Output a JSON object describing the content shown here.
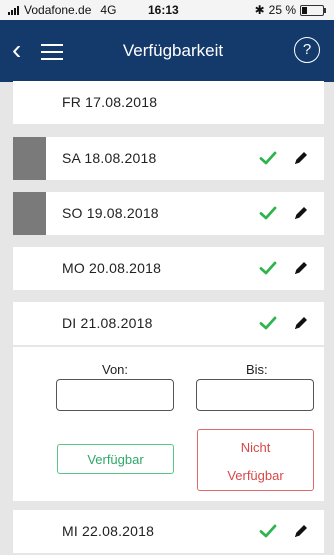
{
  "status_bar": {
    "carrier": "Vodafone.de",
    "network": "4G",
    "time": "16:13",
    "bluetooth": "✱",
    "battery_text": "25 %",
    "battery_level": 0.25
  },
  "header": {
    "back_icon": "‹",
    "title": "Verfügbarkeit",
    "help_label": "?"
  },
  "days": [
    {
      "date": "FR 17.08.2018",
      "marked": false,
      "actions": false
    },
    {
      "date": "SA 18.08.2018",
      "marked": true,
      "actions": true
    },
    {
      "date": "SO 19.08.2018",
      "marked": true,
      "actions": true
    },
    {
      "date": "MO 20.08.2018",
      "marked": false,
      "actions": true
    },
    {
      "date": "DI 21.08.2018",
      "marked": false,
      "actions": true
    },
    {
      "date": "MI 22.08.2018",
      "marked": false,
      "actions": true
    }
  ],
  "editor": {
    "from_label": "Von:",
    "to_label": "Bis:",
    "from_value": "",
    "to_value": "",
    "available_label": "Verfügbar",
    "not_available_line1": "Nicht",
    "not_available_line2": "Verfügbar"
  },
  "colors": {
    "header_bg": "#133a6b",
    "check_green": "#2fb34c",
    "available_green": "#2fa868",
    "not_available_red": "#d84848",
    "marker_grey": "#7a7a7a"
  }
}
